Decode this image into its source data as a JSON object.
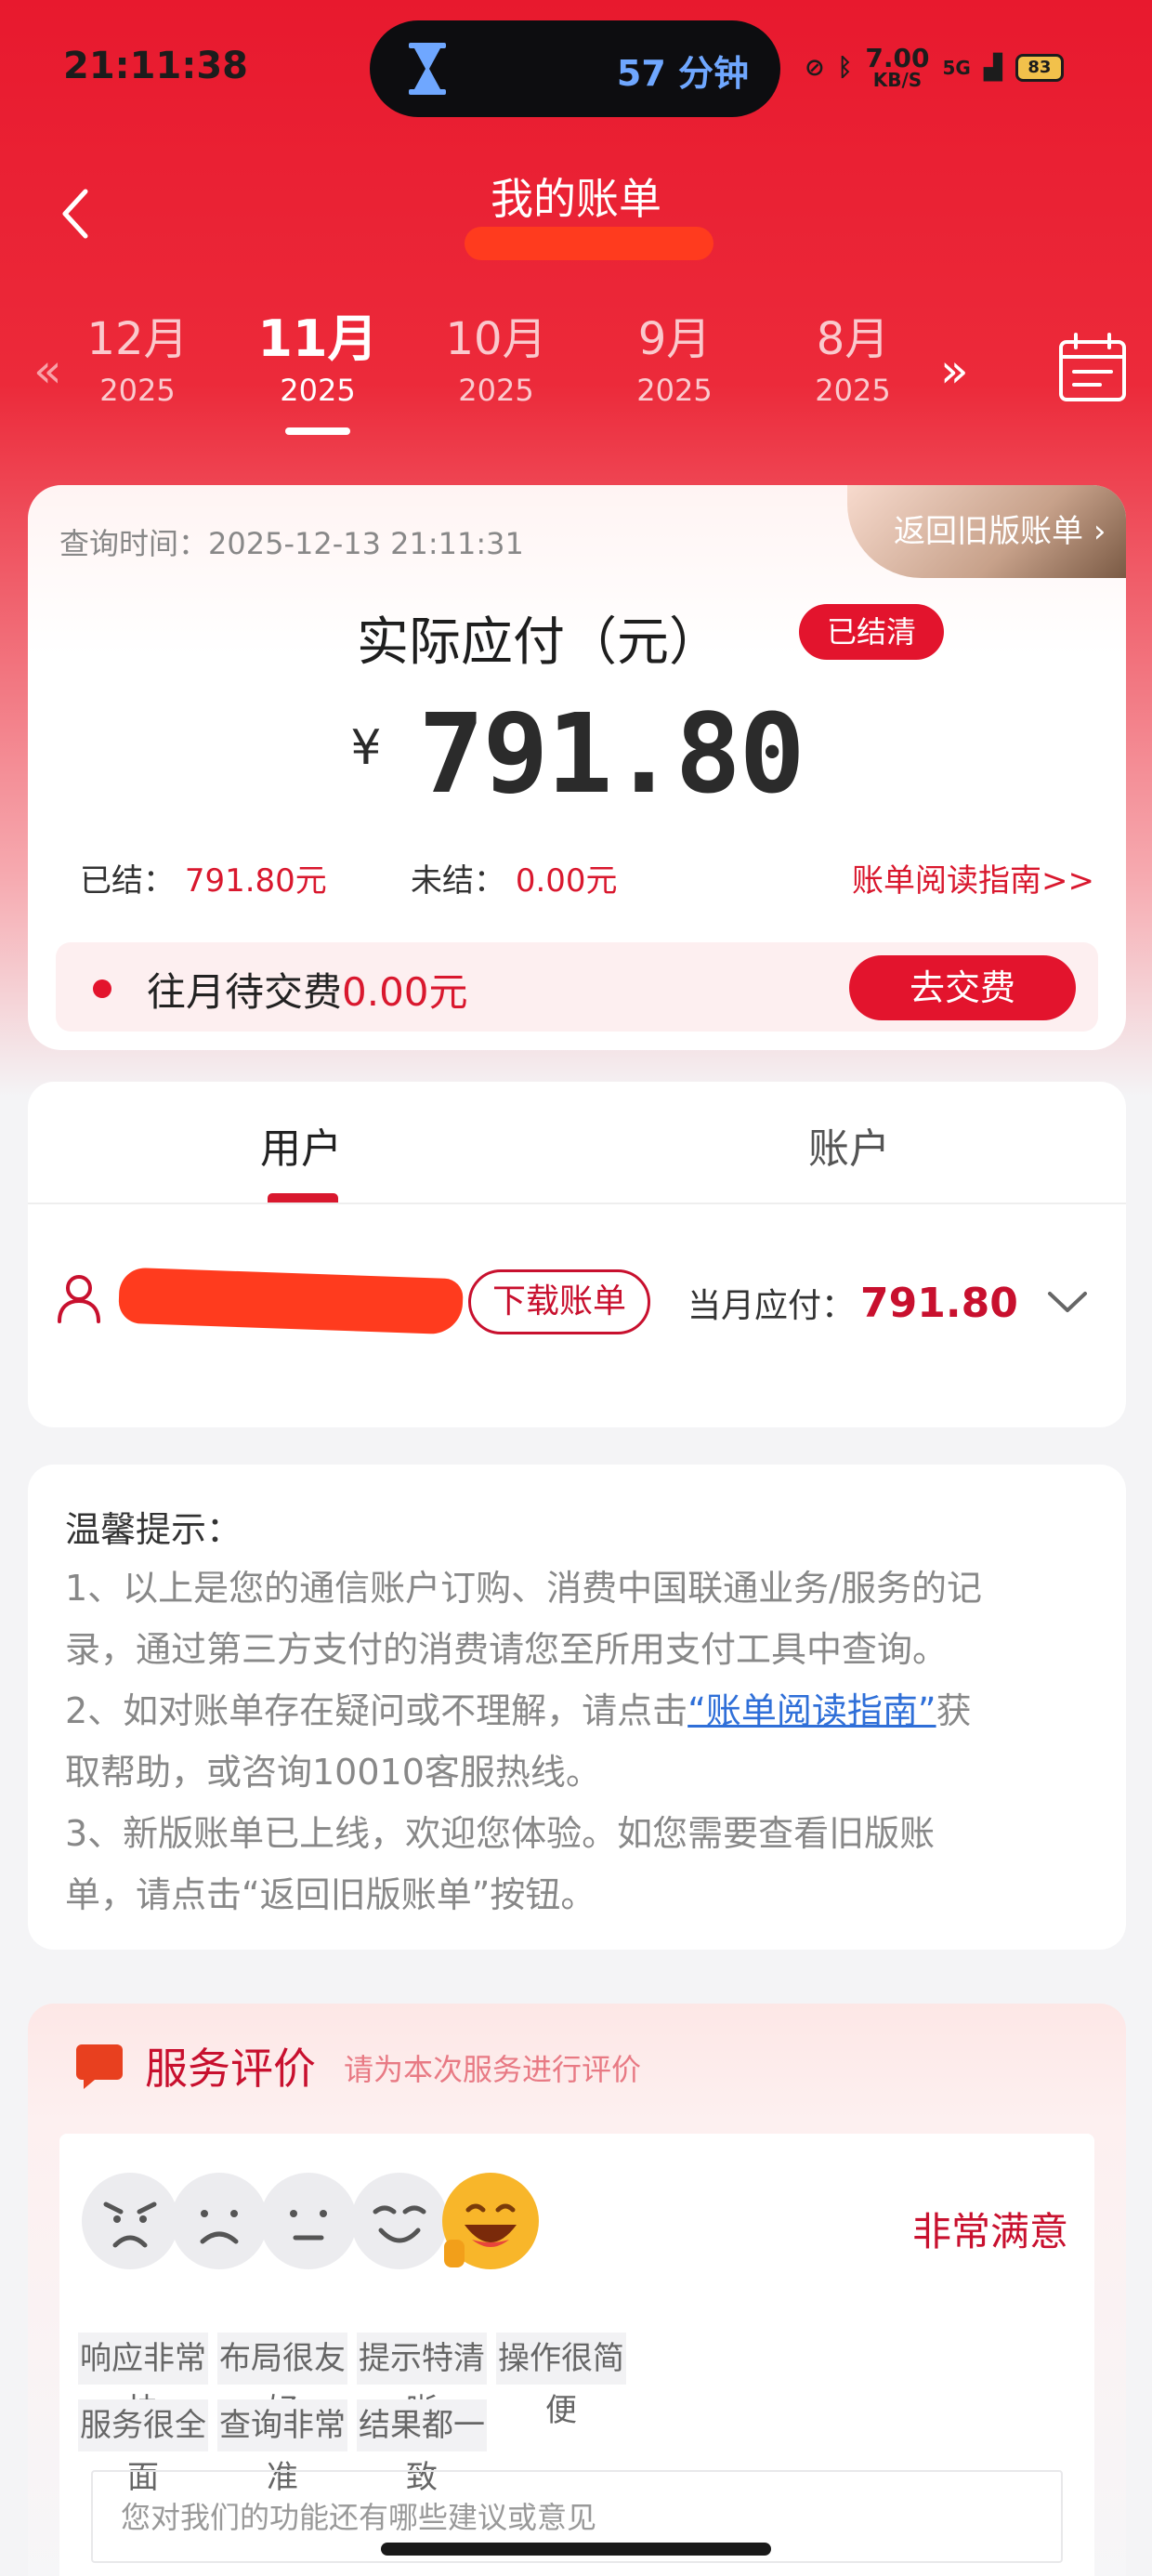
{
  "status_bar": {
    "time": "21:11:38",
    "island_text": "57 分钟",
    "speed_value": "7.00",
    "speed_unit": "KB/S",
    "network": "5G",
    "battery": "83"
  },
  "header": {
    "title": "我的账单"
  },
  "months": [
    {
      "month": "12月",
      "year": "2025",
      "active": false
    },
    {
      "month": "11月",
      "year": "2025",
      "active": true
    },
    {
      "month": "10月",
      "year": "2025",
      "active": false
    },
    {
      "month": "9月",
      "year": "2025",
      "active": false
    },
    {
      "month": "8月",
      "year": "2025",
      "active": false
    }
  ],
  "bill": {
    "query_time": "查询时间：2025-12-13 21:11:31",
    "old_bill_label": "返回旧版账单",
    "payable_title": "实际应付（元）",
    "settled_badge": "已结清",
    "currency": "¥",
    "amount": "791.80",
    "settled_label": "已结：",
    "settled_value": "791.80元",
    "unsettled_label": "未结：",
    "unsettled_value": "0.00元",
    "guide_label": "账单阅读指南>>",
    "pending_label": "往月待交费",
    "pending_value": "0.00元",
    "pay_button": "去交费"
  },
  "tabs": {
    "user": "用户",
    "account": "账户",
    "download_button": "下载账单",
    "month_payable_label": "当月应付：",
    "month_payable_value": "791.80"
  },
  "tips": {
    "title": "温馨提示：",
    "line1a": "1、以上是您的通信账户订购、消费中国联通业务/服务的记",
    "line1b": "录，通过第三方支付的消费请您至所用支付工具中查询。",
    "line2a_pre": "2、如对账单存在疑问或不理解，请点击",
    "line2a_link": "“账单阅读指南”",
    "line2a_post": "获",
    "line2b": "取帮助，或咨询10010客服热线。",
    "line3a": "3、新版账单已上线，欢迎您体验。如您需要查看旧版账",
    "line3b": "单，请点击“返回旧版账单”按钮。"
  },
  "rating": {
    "title": "服务评价",
    "subtitle": "请为本次服务进行评价",
    "selected_label": "非常满意",
    "tags": [
      "响应非常快",
      "布局很友好",
      "提示特清晰",
      "操作很简便",
      "服务很全面",
      "查询非常准",
      "结果都一致"
    ],
    "suggest_placeholder": "您对我们的功能还有哪些建议或意见"
  }
}
